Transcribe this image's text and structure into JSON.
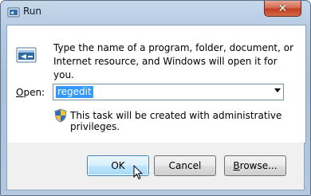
{
  "window": {
    "title": "Run"
  },
  "dialog": {
    "description": "Type the name of a program, folder, document, or Internet resource, and Windows will open it for you.",
    "open_label_accel": "O",
    "open_label_rest": "pen:",
    "open_value": "regedit",
    "admin_note": "This task will be created with administrative privileges."
  },
  "buttons": {
    "ok": "OK",
    "cancel": "Cancel",
    "browse_accel": "B",
    "browse_rest": "rowse..."
  },
  "icons": {
    "close": "close-icon",
    "run": "run-icon",
    "shield": "uac-shield-icon"
  },
  "colors": {
    "selection": "#3399ff",
    "close_button": "#c23e22"
  }
}
